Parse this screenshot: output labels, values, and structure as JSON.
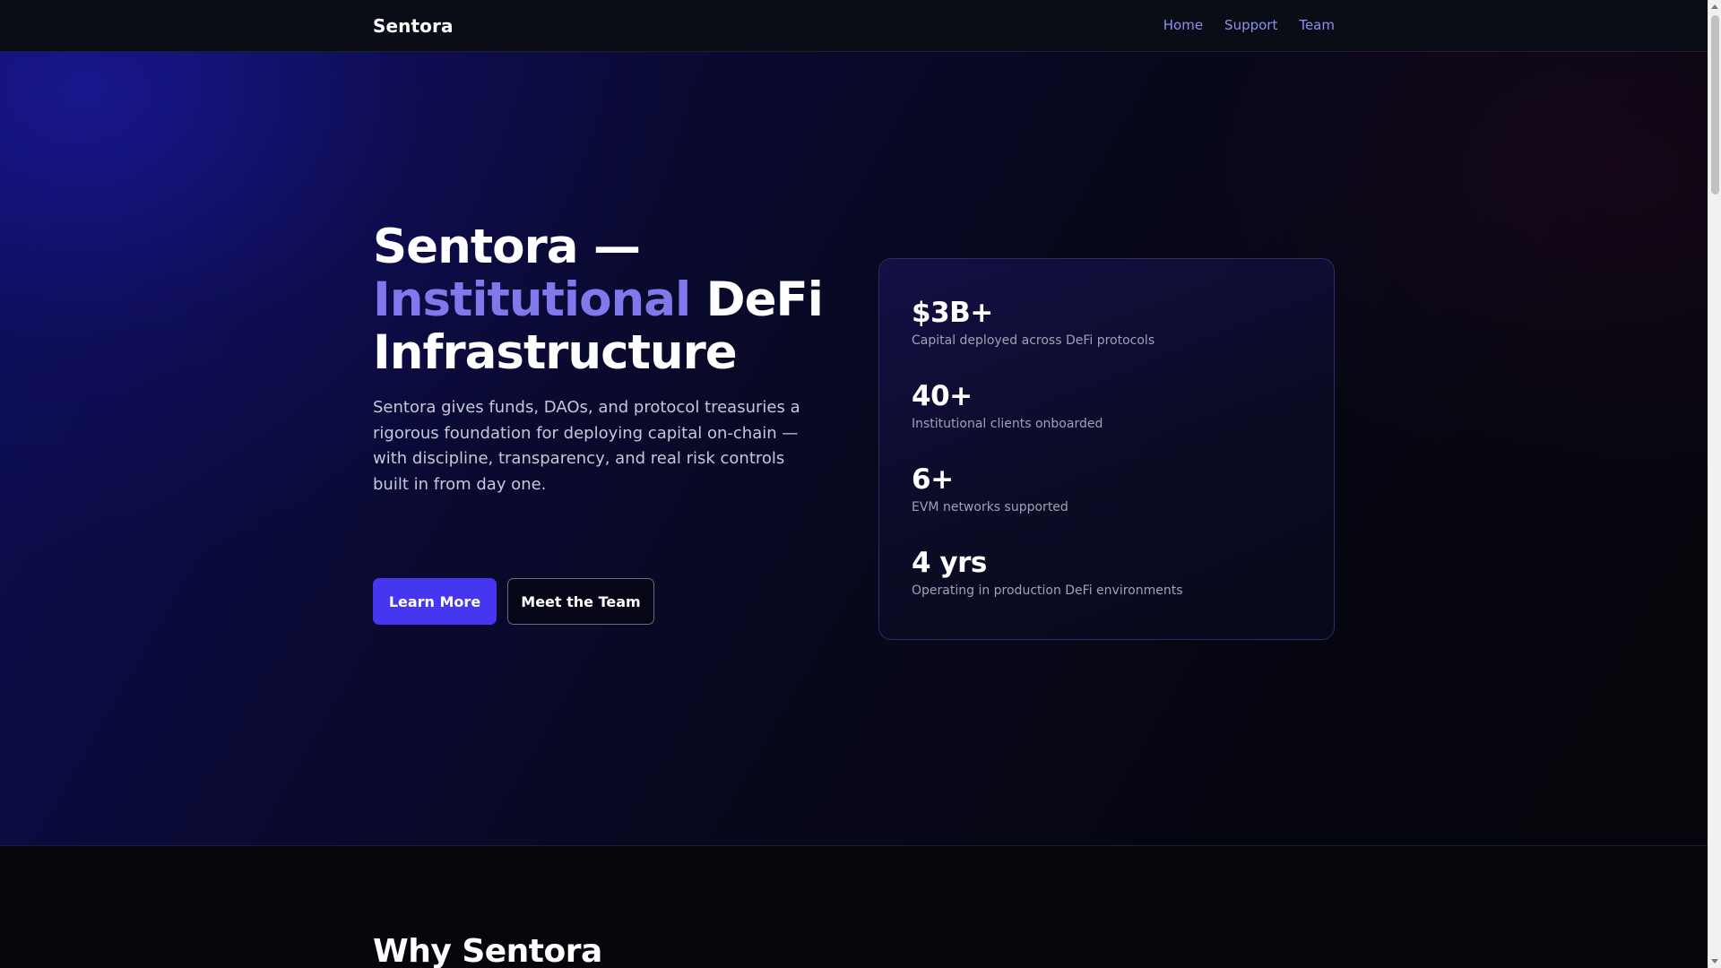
{
  "nav": {
    "brand": "Sentora",
    "links": [
      {
        "label": "Home"
      },
      {
        "label": "Support"
      },
      {
        "label": "Team"
      }
    ]
  },
  "hero": {
    "title_line1": "Sentora —",
    "title_accent": "Institutional",
    "title_line2_rest": " DeFi",
    "title_line3": "Infrastructure",
    "description": "Sentora gives funds, DAOs, and protocol treasuries a rigorous foundation for deploying capital on-chain — with discipline, transparency, and real risk controls built in from day one.",
    "primary_button": "Learn More",
    "secondary_button": "Meet the Team"
  },
  "stats": [
    {
      "value": "$3B+",
      "label": "Capital deployed across DeFi protocols"
    },
    {
      "value": "40+",
      "label": "Institutional clients onboarded"
    },
    {
      "value": "6+",
      "label": "EVM networks supported"
    },
    {
      "value": "4 yrs",
      "label": "Operating in production DeFi environments"
    }
  ],
  "why_section": {
    "title": "Why Sentora"
  },
  "colors": {
    "accent": "#8079ec",
    "primary_button": "#4636f0",
    "nav_link": "#8b8ff0"
  }
}
